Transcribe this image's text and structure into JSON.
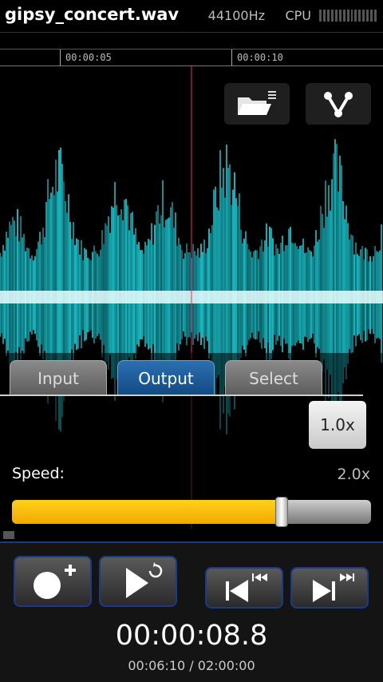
{
  "header": {
    "filename": "gipsy_concert.wav",
    "sample_rate": "44100Hz",
    "cpu_label": "CPU"
  },
  "timeline": {
    "ticks": [
      "00:00:05",
      "00:00:10"
    ]
  },
  "tabs": [
    {
      "label": "Input",
      "active": false
    },
    {
      "label": "Output",
      "active": true
    },
    {
      "label": "Select",
      "active": false
    }
  ],
  "speed": {
    "label": "Speed:",
    "reset_label": "1.0x",
    "max_label": "2.0x",
    "value": 1.5
  },
  "transport": {
    "current_time": "00:00:08.8",
    "position_total": "00:06:10 / 02:00:00"
  },
  "icons": {
    "open_file": "folder-menu-icon",
    "share": "share-icon",
    "record": "record-plus-icon",
    "play": "play-loop-icon",
    "rewind": "skip-back-icon",
    "forward": "skip-forward-icon"
  },
  "colors": {
    "waveform": "#1fe4f0",
    "playhead": "#e0306a",
    "active_tab": "#1f5c9c",
    "slider_fill": "#f7bd00",
    "button_border": "#1d3a8a"
  }
}
